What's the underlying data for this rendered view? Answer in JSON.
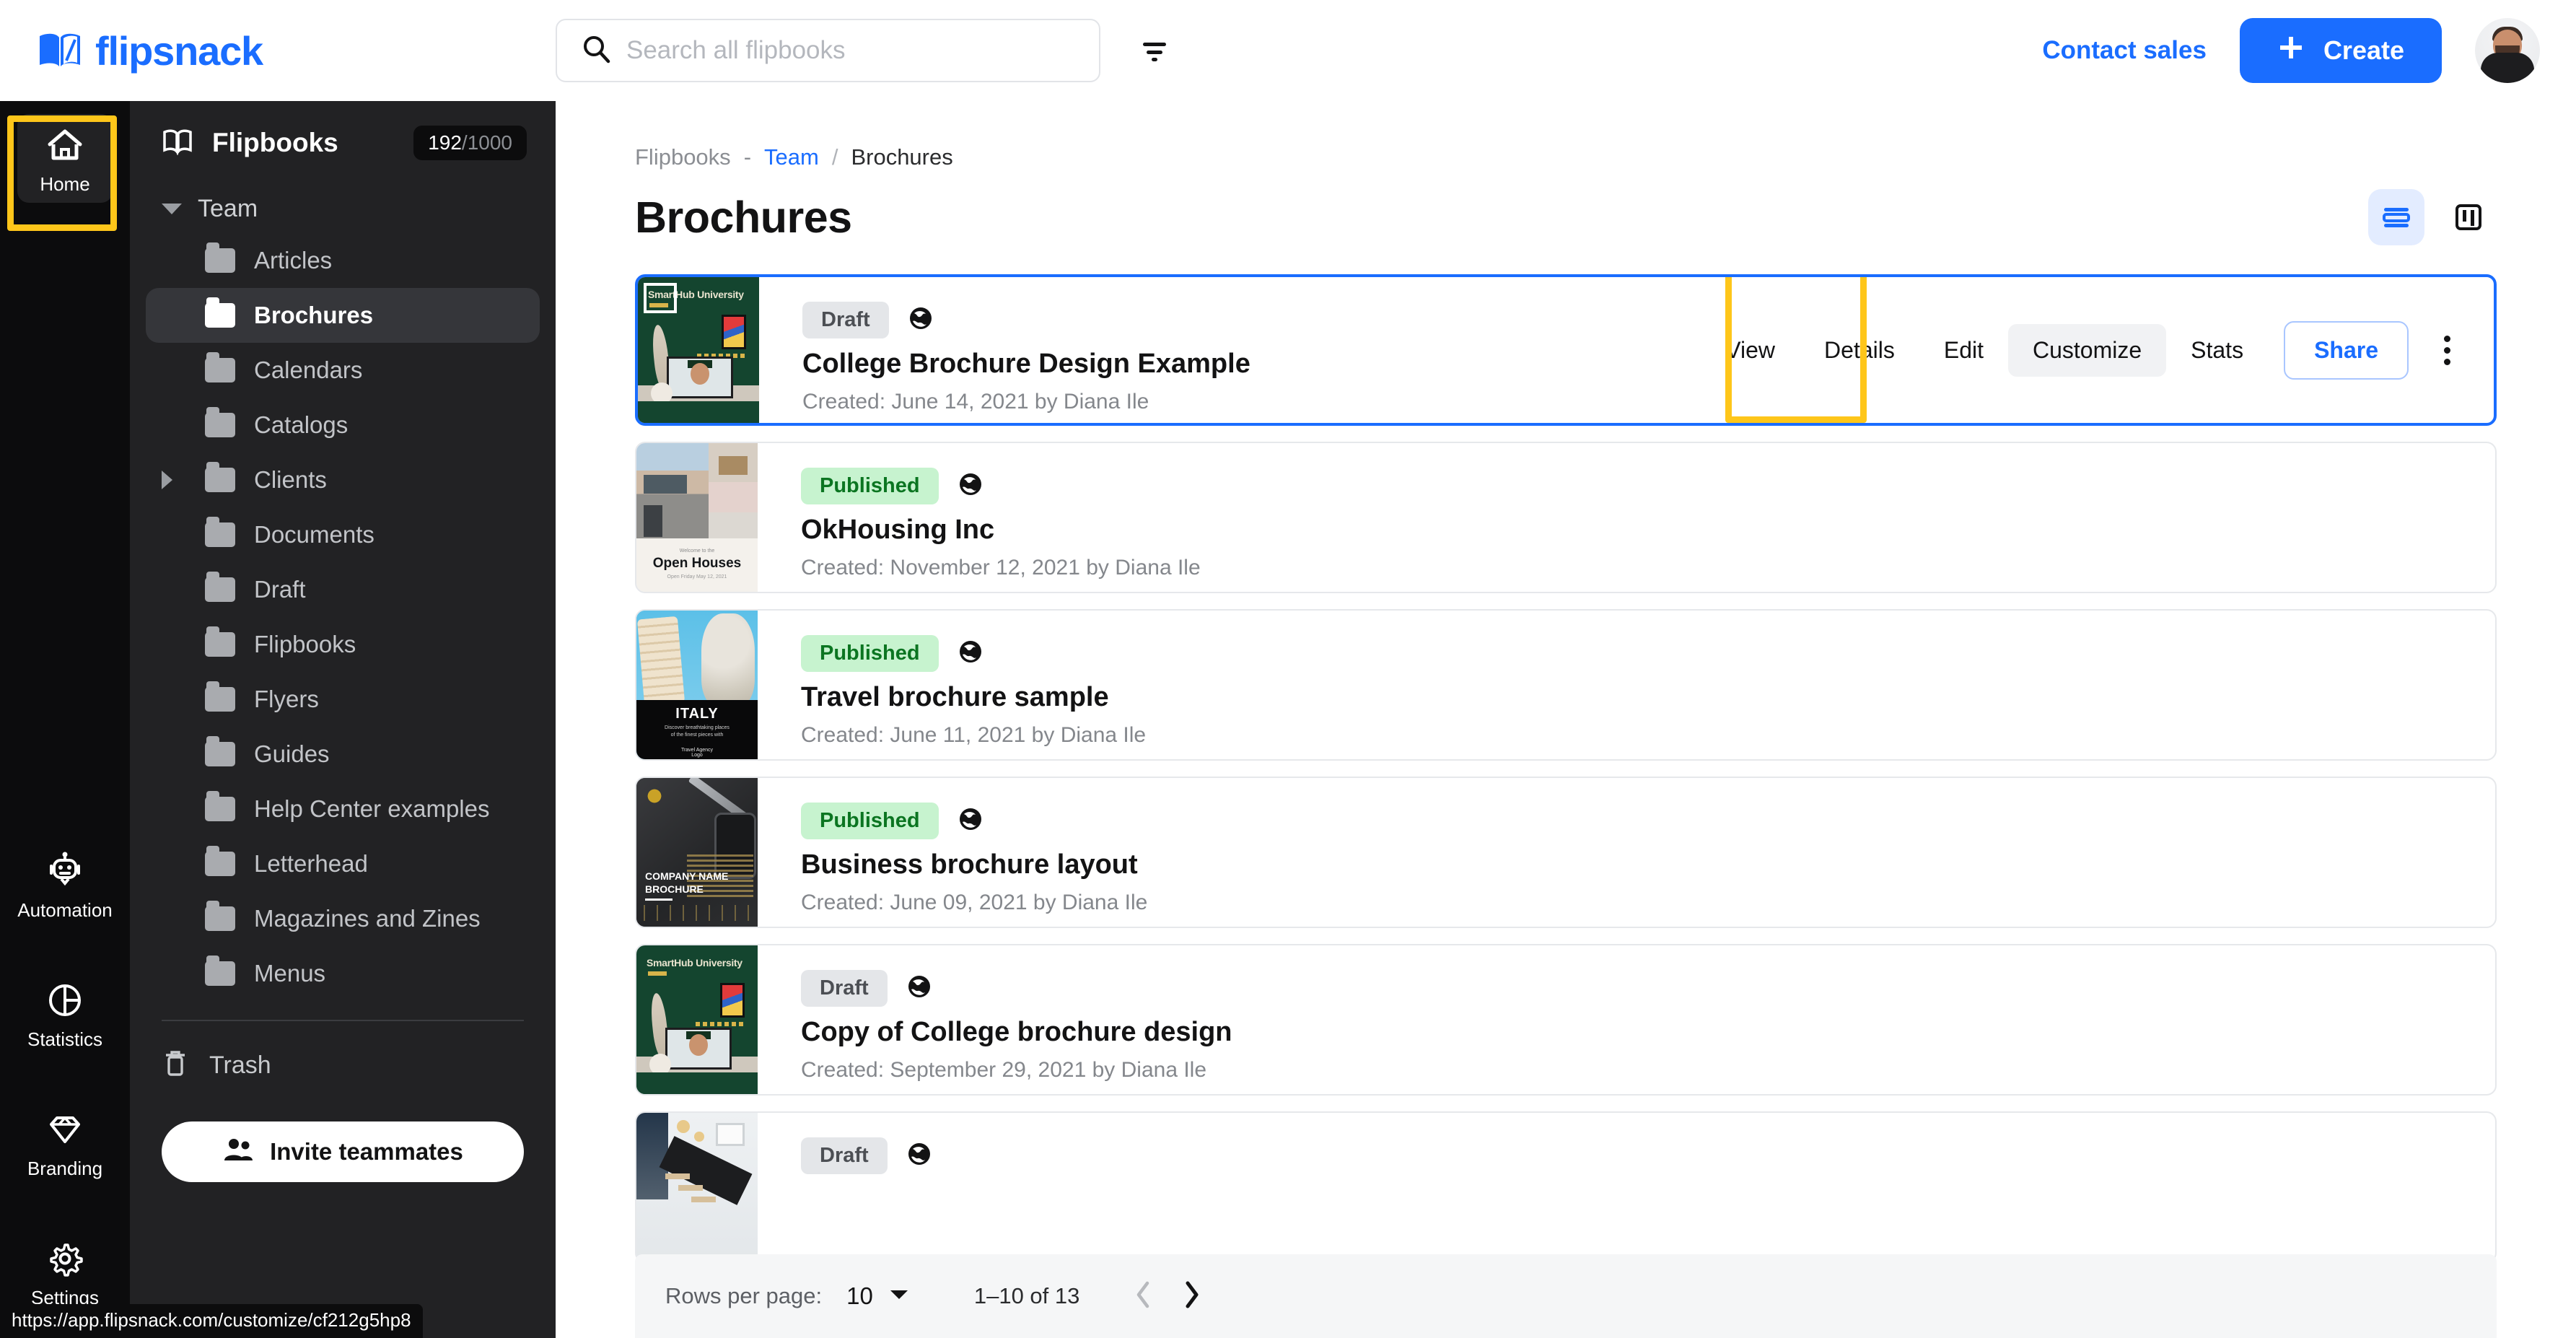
{
  "brand": {
    "name": "flipsnack",
    "color": "#1a6dff",
    "logo_icon": "open-book-icon"
  },
  "header": {
    "search": {
      "placeholder": "Search all flipbooks",
      "value": "",
      "icon": "search-icon"
    },
    "filter_icon": "filter-icon",
    "contact_sales": "Contact sales",
    "create_button": {
      "label": "Create",
      "icon": "plus-icon"
    },
    "avatar": "user-avatar"
  },
  "rail": {
    "top": {
      "label": "Home",
      "icon": "home-icon",
      "highlighted": true
    },
    "bottom": [
      {
        "label": "Automation",
        "icon": "robot-icon"
      },
      {
        "label": "Statistics",
        "icon": "pie-chart-icon"
      },
      {
        "label": "Branding",
        "icon": "diamond-icon"
      },
      {
        "label": "Settings",
        "icon": "gear-icon"
      }
    ]
  },
  "sidebar": {
    "heading": "Flipbooks",
    "heading_icon": "open-book-icon",
    "quota_used": "192",
    "quota_total": "/1000",
    "team_label": "Team",
    "folders": [
      {
        "label": "Articles",
        "expandable": false,
        "selected": false
      },
      {
        "label": "Brochures",
        "expandable": false,
        "selected": true
      },
      {
        "label": "Calendars",
        "expandable": false,
        "selected": false
      },
      {
        "label": "Catalogs",
        "expandable": false,
        "selected": false
      },
      {
        "label": "Clients",
        "expandable": true,
        "selected": false
      },
      {
        "label": "Documents",
        "expandable": false,
        "selected": false
      },
      {
        "label": "Draft",
        "expandable": false,
        "selected": false
      },
      {
        "label": "Flipbooks",
        "expandable": false,
        "selected": false
      },
      {
        "label": "Flyers",
        "expandable": false,
        "selected": false
      },
      {
        "label": "Guides",
        "expandable": false,
        "selected": false
      },
      {
        "label": "Help Center examples",
        "expandable": false,
        "selected": false
      },
      {
        "label": "Letterhead",
        "expandable": false,
        "selected": false
      },
      {
        "label": "Magazines and Zines",
        "expandable": false,
        "selected": false
      },
      {
        "label": "Menus",
        "expandable": false,
        "selected": false
      }
    ],
    "trash": {
      "label": "Trash",
      "icon": "trash-icon"
    },
    "invite": {
      "label": "Invite teammates",
      "icon": "people-icon"
    }
  },
  "status_bar": {
    "url": "https://app.flipsnack.com/customize/cf212g5hp8"
  },
  "main": {
    "breadcrumb": {
      "root": "Flipbooks",
      "dash": "-",
      "team": "Team",
      "sep": "/",
      "current": "Brochures"
    },
    "page_title": "Brochures",
    "view_toggles": [
      {
        "name": "list-view",
        "icon": "list-view-icon",
        "active": true
      },
      {
        "name": "grid-view",
        "icon": "board-view-icon",
        "active": false
      }
    ],
    "row_actions": {
      "view": "View",
      "details": "Details",
      "edit": "Edit",
      "customize": "Customize",
      "stats": "Stats",
      "share": "Share",
      "more_icon": "kebab-menu-icon"
    },
    "highlight_color": "#fec61a",
    "rows": [
      {
        "status": "Draft",
        "status_type": "draft",
        "globe_icon": "globe-icon",
        "title": "College Brochure Design Example",
        "meta": "Created: June 14, 2021 by Diana Ile",
        "thumb": "college-brochure-thumbnail",
        "thumb_text": "SmartHub University",
        "active": true,
        "show_actions": true
      },
      {
        "status": "Published",
        "status_type": "published",
        "globe_icon": "globe-icon",
        "title": "OkHousing Inc",
        "meta": "Created: November 12, 2021 by Diana Ile",
        "thumb": "open-houses-thumbnail",
        "thumb_text": "Open Houses",
        "active": false,
        "show_actions": false
      },
      {
        "status": "Published",
        "status_type": "published",
        "globe_icon": "globe-icon",
        "title": "Travel brochure sample",
        "meta": "Created: June 11, 2021 by Diana Ile",
        "thumb": "italy-travel-thumbnail",
        "thumb_text": "ITALY",
        "active": false,
        "show_actions": false
      },
      {
        "status": "Published",
        "status_type": "published",
        "globe_icon": "globe-icon",
        "title": "Business brochure layout",
        "meta": "Created: June 09, 2021 by Diana Ile",
        "thumb": "business-brochure-thumbnail",
        "thumb_text": "COMPANY NAME BROCHURE",
        "active": false,
        "show_actions": false
      },
      {
        "status": "Draft",
        "status_type": "draft",
        "globe_icon": "globe-icon",
        "title": "Copy of College brochure design",
        "meta": "Created: September 29, 2021 by Diana Ile",
        "thumb": "college-brochure-thumbnail",
        "thumb_text": "SmartHub University",
        "active": false,
        "show_actions": false
      },
      {
        "status": "Draft",
        "status_type": "draft",
        "globe_icon": "globe-icon",
        "title": "",
        "meta": "",
        "thumb": "interior-stairs-thumbnail",
        "thumb_text": "",
        "active": false,
        "show_actions": false
      }
    ],
    "pagination": {
      "rows_per_page_label": "Rows per page:",
      "rows_per_page_value": "10",
      "range": "1–10 of 13",
      "prev_icon": "chevron-left-icon",
      "next_icon": "chevron-right-icon",
      "prev_enabled": false,
      "next_enabled": true
    }
  }
}
